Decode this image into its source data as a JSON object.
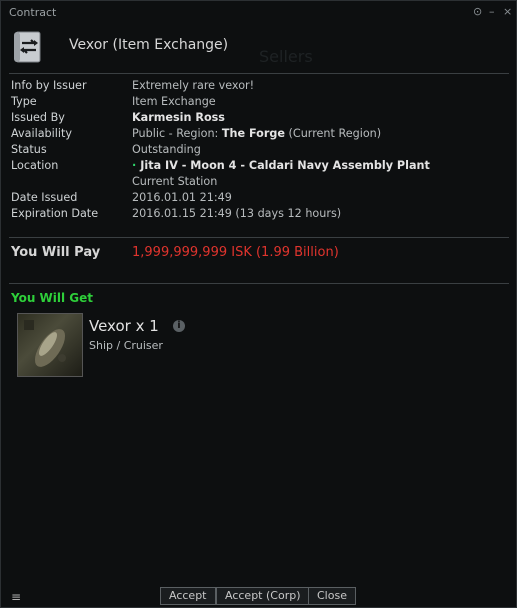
{
  "window": {
    "title": "Contract",
    "controls": [
      "⊙",
      "–",
      "×"
    ]
  },
  "header": {
    "title": "Vexor (Item Exchange)"
  },
  "info": {
    "rows": [
      {
        "label": "Info by Issuer",
        "value": "Extremely rare vexor!"
      },
      {
        "label": "Type",
        "value": "Item Exchange"
      },
      {
        "label": "Issued By",
        "value": "Karmesin Ross"
      },
      {
        "label": "Availability",
        "value_prefix": "Public - Region: ",
        "value_bold": "The Forge",
        "value_suffix": " (Current Region)"
      },
      {
        "label": "Status",
        "value": "Outstanding"
      },
      {
        "label": "Location",
        "value": "Jita IV - Moon 4 - Caldari Navy Assembly Plant",
        "value2": "Current Station"
      },
      {
        "label": "Date Issued",
        "value": "2016.01.01 21:49"
      },
      {
        "label": "Expiration Date",
        "value": "2016.01.15 21:49 (13 days 12 hours)"
      }
    ]
  },
  "payment": {
    "label": "You Will Pay",
    "value": "1,999,999,999 ISK (1.99 Billion)",
    "color": "#e0342d"
  },
  "receive": {
    "label": "You Will Get",
    "item_name": "Vexor x 1",
    "item_sub": "Ship / Cruiser",
    "info_icon": "i"
  },
  "buttons": {
    "accept": "Accept",
    "accept_corp": "Accept (Corp)",
    "close": "Close"
  },
  "menu_icon": "≡"
}
